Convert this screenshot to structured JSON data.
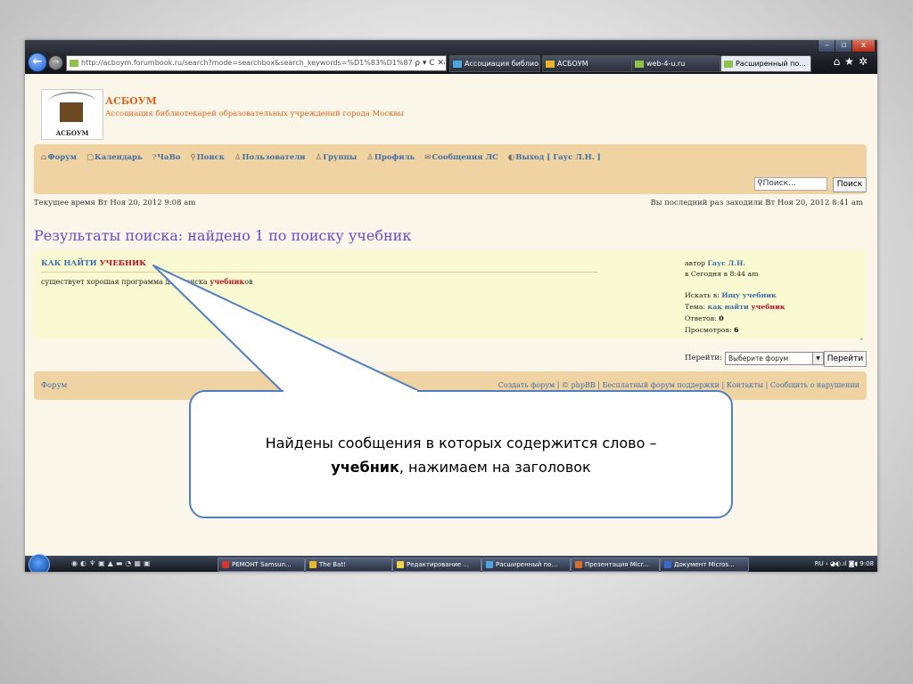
{
  "browser": {
    "url": "http://acboym.forumbook.ru/search?mode=searchbox&search_keywords=%D1%83%D1%87%D0%B5%",
    "url_controls": "ρ ▾ C ✕",
    "tabs": [
      {
        "label": "Ассоциация библио..."
      },
      {
        "label": "АСБОУМ"
      },
      {
        "label": "web-4-u.ru"
      },
      {
        "label": "Расширенный по..."
      }
    ],
    "tab_close": "×",
    "window_controls": {
      "minimize": "–",
      "maximize": "▫",
      "close": "x"
    },
    "toolbar_icons": "⌂★✲"
  },
  "site": {
    "logo_text": "АСБОУМ",
    "name": "АСБОУМ",
    "description": "Ассоциация библиотекарей образовательных учреждений города Москвы"
  },
  "nav": {
    "items": [
      {
        "icon": "⌂",
        "label": "Форум"
      },
      {
        "icon": "▢",
        "label": "Календарь"
      },
      {
        "icon": "?",
        "label": "ЧаВо"
      },
      {
        "icon": "⚲",
        "label": "Поиск"
      },
      {
        "icon": "♙",
        "label": "Пользователи"
      },
      {
        "icon": "♙",
        "label": "Группы"
      },
      {
        "icon": "♙",
        "label": "Профиль"
      },
      {
        "icon": "✉",
        "label": "Сообщения ЛС"
      },
      {
        "icon": "◐",
        "label": "Выход [ Гаус Л.Н. ]"
      }
    ],
    "search_placeholder": "Поиск...",
    "search_button": "Поиск"
  },
  "status": {
    "current_time": "Текущее время Вт Ноя 20, 2012 9:08 am",
    "last_visit": "Вы последний раз заходили Вт Ноя 20, 2012 8:41 am"
  },
  "page_title": "Результаты поиска: найдено 1 по поиску учебник",
  "result": {
    "title_prefix": "КАК НАЙТИ ",
    "title_highlight": "УЧЕБНИК",
    "snippet_prefix": "существует хорошая программа для поиска ",
    "snippet_highlight": "учебник",
    "snippet_suffix": "ов",
    "author_label": "автор ",
    "author": "Гаус Л.Н.",
    "date_label": "в ",
    "date": "Сегодня в 8:44 am",
    "search_in_label": "Искать в: ",
    "search_in": "Ищу учебник",
    "topic_label": "Тема: ",
    "topic_prefix": "как найти ",
    "topic_highlight": "учебник",
    "replies_label": "Ответов: ",
    "replies": "0",
    "views_label": "Просмотров: ",
    "views": "6"
  },
  "jump": {
    "scroll_up": "˄",
    "label": "Перейти:",
    "select_value": "Выберите форум",
    "select_arrow": "▼",
    "button": "Перейти"
  },
  "footer": {
    "left": "Форум",
    "right": "Создать форум | © phpBB | Бесплатный форум поддержки | Контакты | Сообщить о нарушении"
  },
  "taskbar": {
    "quick_icons": "◉◐♆▣▲▬◔▦▣",
    "items": [
      {
        "label": "РЕМОНТ Samsun...",
        "color": "#d8342c"
      },
      {
        "label": "The Bat!",
        "color": "#e8b42c"
      },
      {
        "label": "Редактирование ...",
        "color": "#f2d44a"
      },
      {
        "label": "Расширенный по...",
        "color": "#4fa3e0"
      },
      {
        "label": "Презентация Micr...",
        "color": "#d86a2c"
      },
      {
        "label": "Документ Micros...",
        "color": "#3a6ad0"
      }
    ],
    "tray": "RU  ‹ ◕◐.ıl ◙◖  9:08"
  },
  "callout": {
    "line1": "Найдены сообщения в которых содержится слово –",
    "bold_word": "учебник",
    "line2_suffix": ",  нажимаем  на заголовок"
  },
  "colors": {
    "callout_border": "#4f7fc2",
    "link": "#3f6ea6",
    "highlight": "#b5151e",
    "title": "#6a4bc8",
    "panel": "#f0d3a3",
    "result_bg": "#fafad2"
  }
}
